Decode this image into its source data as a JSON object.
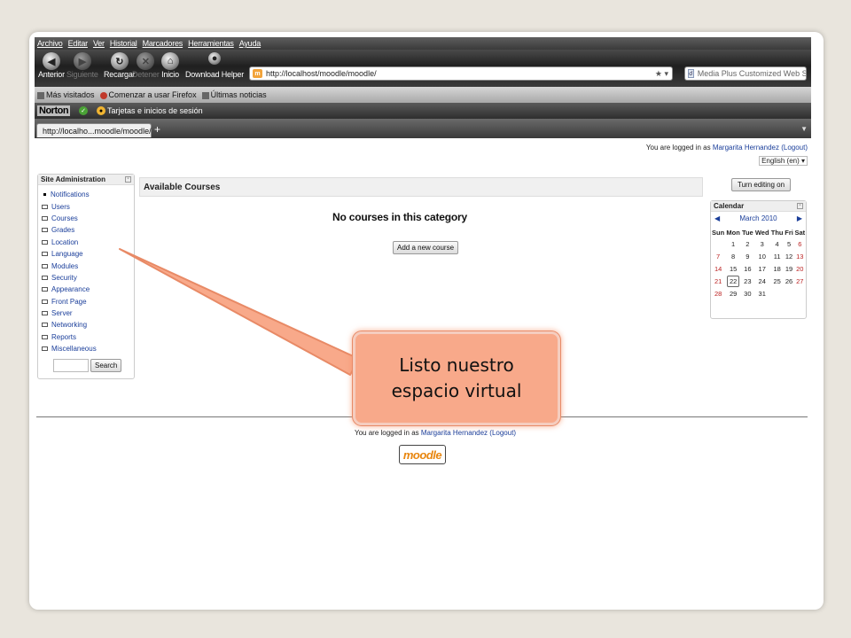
{
  "menubar": [
    "Archivo",
    "Editar",
    "Ver",
    "Historial",
    "Marcadores",
    "Herramientas",
    "Ayuda"
  ],
  "nav": {
    "back": "Anterior",
    "forward": "Siguiente",
    "reload": "Recargar",
    "stop": "Detener",
    "home": "Inicio",
    "download_helper": "Download Helper"
  },
  "url": "http://localhost/moodle/moodle/",
  "search_placeholder": "Media Plus Customized Web Se",
  "bookmarks": [
    "Más visitados",
    "Comenzar a usar Firefox",
    "Últimas noticias"
  ],
  "norton": {
    "logo": "Norton",
    "cards": "Tarjetas e inicios de sesión"
  },
  "tab_title": "http://localho...moodle/moodle/",
  "page": {
    "login_prefix": "You are logged in as",
    "user_name": "Margarita Hernandez",
    "logout": "(Logout)",
    "language": "English (en)",
    "admin_block": {
      "title": "Site Administration",
      "items": [
        "Notifications",
        "Users",
        "Courses",
        "Grades",
        "Location",
        "Language",
        "Modules",
        "Security",
        "Appearance",
        "Front Page",
        "Server",
        "Networking",
        "Reports",
        "Miscellaneous"
      ],
      "search_button": "Search"
    },
    "courses": {
      "title": "Available Courses",
      "empty": "No courses in this category",
      "add_button": "Add a new course"
    },
    "turn_editing": "Turn editing on",
    "calendar": {
      "title": "Calendar",
      "month": "March 2010",
      "days": [
        "Sun",
        "Mon",
        "Tue",
        "Wed",
        "Thu",
        "Fri",
        "Sat"
      ],
      "weeks": [
        [
          "",
          "1",
          "2",
          "3",
          "4",
          "5",
          "6"
        ],
        [
          "7",
          "8",
          "9",
          "10",
          "11",
          "12",
          "13"
        ],
        [
          "14",
          "15",
          "16",
          "17",
          "18",
          "19",
          "20"
        ],
        [
          "21",
          "22",
          "23",
          "24",
          "25",
          "26",
          "27"
        ],
        [
          "28",
          "29",
          "30",
          "31",
          "",
          "",
          ""
        ]
      ],
      "today": "22"
    },
    "moodle_logo": "moodle"
  },
  "callout": "Listo nuestro espacio virtual",
  "colors": {
    "callout_fill": "#f8a98a",
    "link": "#1a3e9a",
    "weekend": "#b22222",
    "moodle_orange": "#e8860f"
  }
}
